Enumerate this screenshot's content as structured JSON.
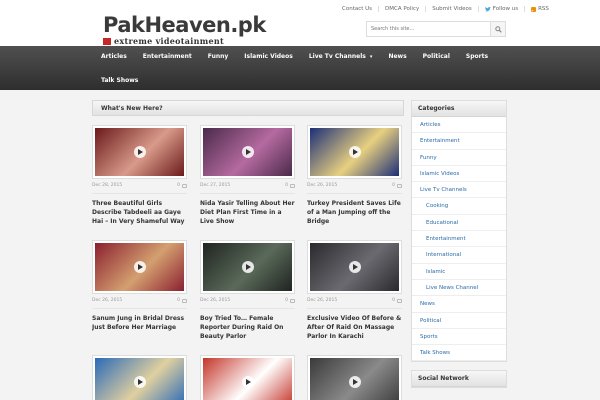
{
  "brand": {
    "title": "PakHeaven.pk",
    "tagline": "extreme videotainment"
  },
  "toplinks": [
    {
      "label": "Contact Us"
    },
    {
      "label": "DMCA Policy"
    },
    {
      "label": "Submit Videos"
    },
    {
      "label": "Follow us"
    },
    {
      "label": "RSS"
    }
  ],
  "search": {
    "placeholder": "Search this site..."
  },
  "nav": {
    "items": [
      "Articles",
      "Entertainment",
      "Funny",
      "Islamic Videos",
      "Live Tv Channels",
      "News",
      "Political",
      "Sports"
    ],
    "dropdown_marker": "▾",
    "row2": [
      "Talk Shows"
    ]
  },
  "main": {
    "heading": "What's New Here?",
    "posts": [
      {
        "date": "Dec 28, 2015",
        "comments": "0",
        "title": "Three Beautiful Girls Describe Tabdeeli aa Gaye Hai – In Very Shameful Way",
        "colors": [
          "#6b1a1a",
          "#d89a8a"
        ]
      },
      {
        "date": "Dec 27, 2015",
        "comments": "0",
        "title": "Nida Yasir Telling About Her Diet Plan First Time in a Live Show",
        "colors": [
          "#4a2a4a",
          "#b56aa0"
        ]
      },
      {
        "date": "Dec 26, 2015",
        "comments": "0",
        "title": "Turkey President Saves Life of a Man Jumping off the Bridge",
        "colors": [
          "#1c2f78",
          "#e8d080"
        ]
      },
      {
        "date": "Dec 26, 2015",
        "comments": "0",
        "title": "Sanum Jung in Bridal Dress Just Before Her Marriage",
        "colors": [
          "#8a2030",
          "#d4a070"
        ]
      },
      {
        "date": "Dec 26, 2015",
        "comments": "0",
        "title": "Boy Tried To… Female Reporter During Raid On Beauty Parlor",
        "colors": [
          "#1f2420",
          "#5a6a5a"
        ]
      },
      {
        "date": "Dec 26, 2015",
        "comments": "0",
        "title": "Exclusive Video Of Before & After Of Raid On Massage Parlor In Karachi",
        "colors": [
          "#2a2a2e",
          "#6a6a70"
        ]
      },
      {
        "date": "",
        "comments": "",
        "title": "",
        "colors": [
          "#2a6ab8",
          "#e0d0a0"
        ]
      },
      {
        "date": "",
        "comments": "",
        "title": "",
        "colors": [
          "#c4352a",
          "#ffffff"
        ]
      },
      {
        "date": "",
        "comments": "",
        "title": "",
        "colors": [
          "#3a3a3a",
          "#8a8a8a"
        ]
      }
    ]
  },
  "sidebar": {
    "categories_heading": "Categories",
    "categories": [
      {
        "label": "Articles",
        "sub": false
      },
      {
        "label": "Entertainment",
        "sub": false
      },
      {
        "label": "Funny",
        "sub": false
      },
      {
        "label": "Islamic Videos",
        "sub": false
      },
      {
        "label": "Live Tv Channels",
        "sub": false
      },
      {
        "label": "Cooking",
        "sub": true
      },
      {
        "label": "Educational",
        "sub": true
      },
      {
        "label": "Entertainment",
        "sub": true
      },
      {
        "label": "International",
        "sub": true
      },
      {
        "label": "Islamic",
        "sub": true
      },
      {
        "label": "Live News Channel",
        "sub": true
      },
      {
        "label": "News",
        "sub": false
      },
      {
        "label": "Political",
        "sub": false
      },
      {
        "label": "Sports",
        "sub": false
      },
      {
        "label": "Talk Shows",
        "sub": false
      }
    ],
    "social_heading": "Social Network"
  }
}
